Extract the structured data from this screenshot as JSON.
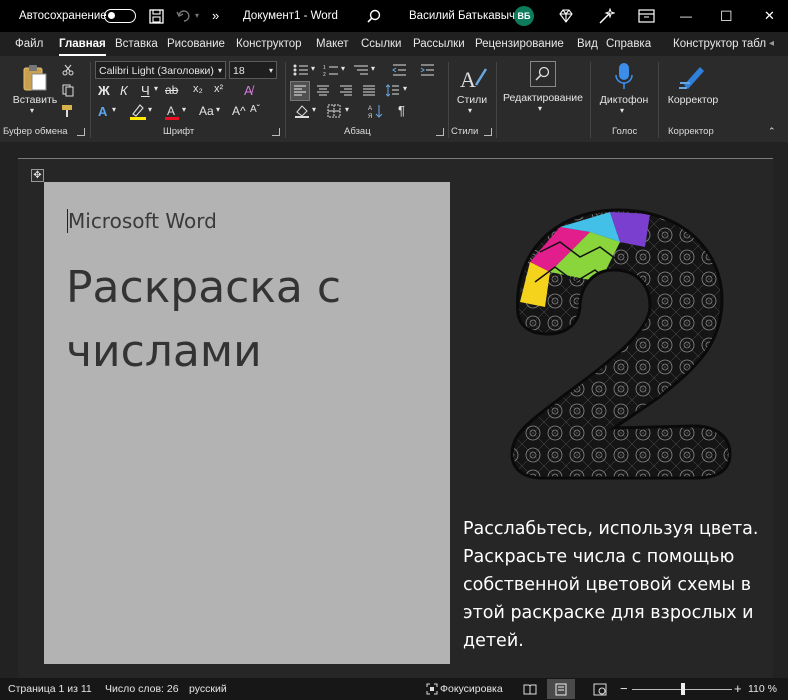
{
  "titlebar": {
    "autosave_label": "Автосохранение",
    "doc_title": "Документ1  -  Word",
    "user_name": "Василий Батькавыч",
    "user_initials": "ВБ",
    "overflow": "»",
    "minimize": "—",
    "maximize": "☐",
    "close": "✕"
  },
  "tabs": [
    "Файл",
    "Главная",
    "Вставка",
    "Рисование",
    "Конструктор",
    "Макет",
    "Ссылки",
    "Рассылки",
    "Рецензирование",
    "Вид",
    "Справка",
    "Конструктор табл"
  ],
  "ribbon": {
    "paste_label": "Вставить",
    "font_name": "Calibri Light (Заголовки)",
    "font_size": "18",
    "bold": "Ж",
    "italic": "К",
    "underline": "Ч",
    "styles_label": "Стили",
    "editing_label": "Редактирование",
    "dictate_label": "Диктофон",
    "editor_label": "Корректор",
    "groups": {
      "clipboard": "Буфер обмена",
      "font": "Шрифт",
      "paragraph": "Абзац",
      "styles": "Стили",
      "voice": "Голос",
      "editor": "Корректор"
    }
  },
  "document": {
    "subtitle": "Microsoft Word",
    "title": "Раскраска с числами",
    "big_numeral": "2",
    "paragraph": "Расслабьтесь, используя цвета. Раскрасьте числа с помощью собственной цветовой схемы в этой раскраске для взрослых и детей."
  },
  "statusbar": {
    "page": "Страница 1 из 11",
    "words": "Число слов: 26",
    "language": "русский",
    "focus": "Фокусировка",
    "zoom": "110 %",
    "zoom_percent": 110
  },
  "colors": {
    "accent": "#0e7c5c",
    "titlebar_bg": "#000000",
    "ribbon_bg": "#2b2b2b",
    "canvas_bg": "#222222",
    "graybox_bg": "#b3b3b3"
  }
}
